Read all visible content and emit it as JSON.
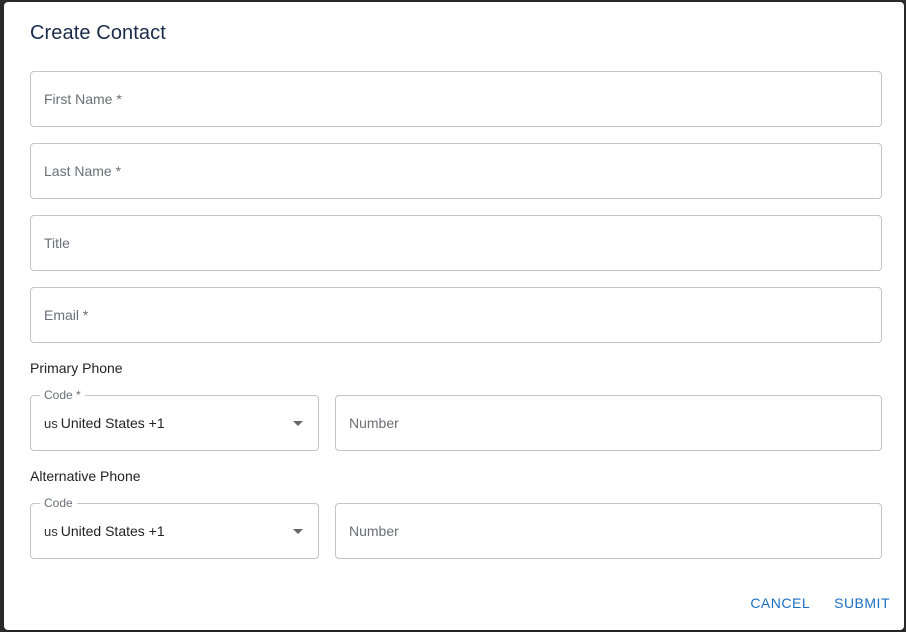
{
  "dialog": {
    "title": "Create Contact"
  },
  "fields": {
    "first_name": "First Name *",
    "last_name": "Last Name *",
    "title": "Title",
    "email": "Email *"
  },
  "primary_phone": {
    "label": "Primary Phone",
    "code_label": "Code *",
    "code_country_abbr": "us",
    "code_value": "United States +1",
    "number_placeholder": "Number"
  },
  "alternative_phone": {
    "label": "Alternative Phone",
    "code_label": "Code",
    "code_country_abbr": "us",
    "code_value": "United States +1",
    "number_placeholder": "Number"
  },
  "actions": {
    "cancel": "CANCEL",
    "submit": "SUBMIT"
  },
  "colors": {
    "accent": "#1b6fc2",
    "title": "#1a2b4a",
    "border": "#c4c4c4"
  }
}
